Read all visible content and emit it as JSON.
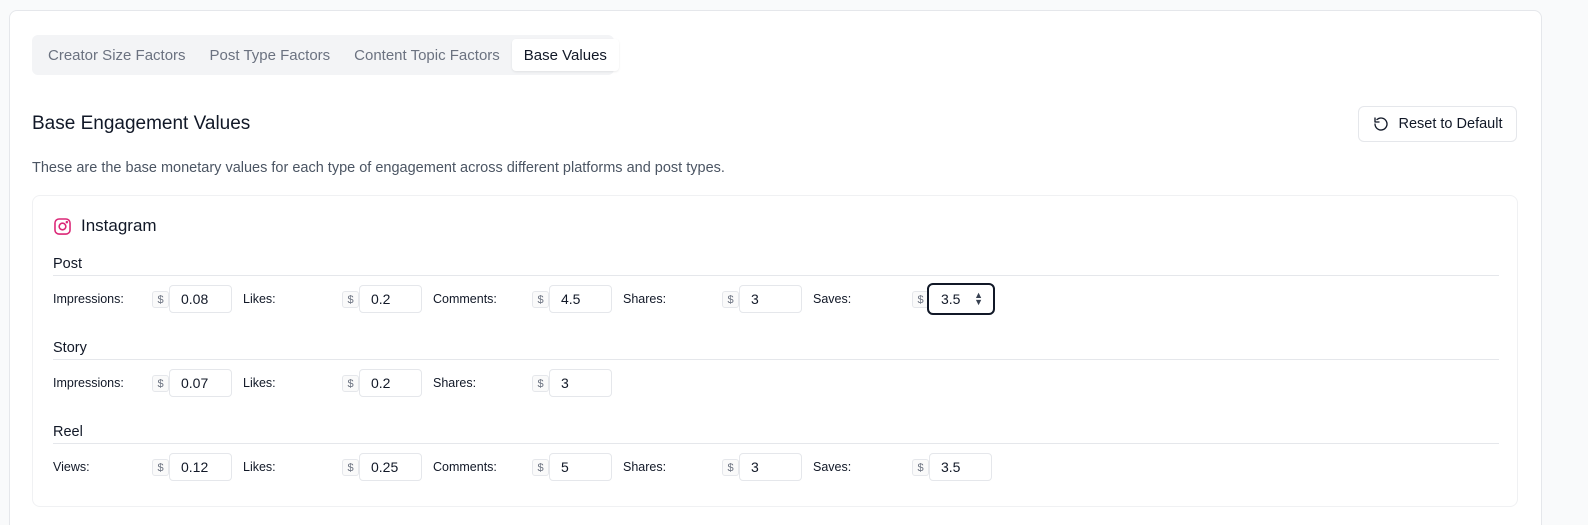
{
  "tabs": [
    {
      "label": "Creator Size Factors",
      "active": false
    },
    {
      "label": "Post Type Factors",
      "active": false
    },
    {
      "label": "Content Topic Factors",
      "active": false
    },
    {
      "label": "Base Values",
      "active": true
    }
  ],
  "section": {
    "title": "Base Engagement Values",
    "description": "These are the base monetary values for each type of engagement across different platforms and post types.",
    "reset_label": "Reset to Default"
  },
  "platform": {
    "name": "Instagram",
    "icon": "instagram-icon",
    "accent": "#db2777"
  },
  "currency_symbol": "$",
  "groups": {
    "post": {
      "title": "Post",
      "fields": [
        {
          "label": "Impressions:",
          "value": "0.08"
        },
        {
          "label": "Likes:",
          "value": "0.2"
        },
        {
          "label": "Comments:",
          "value": "4.5"
        },
        {
          "label": "Shares:",
          "value": "3"
        },
        {
          "label": "Saves:",
          "value": "3.5"
        }
      ]
    },
    "story": {
      "title": "Story",
      "fields": [
        {
          "label": "Impressions:",
          "value": "0.07"
        },
        {
          "label": "Likes:",
          "value": "0.2"
        },
        {
          "label": "Shares:",
          "value": "3"
        }
      ]
    },
    "reel": {
      "title": "Reel",
      "fields": [
        {
          "label": "Views:",
          "value": "0.12"
        },
        {
          "label": "Likes:",
          "value": "0.25"
        },
        {
          "label": "Comments:",
          "value": "5"
        },
        {
          "label": "Shares:",
          "value": "3"
        },
        {
          "label": "Saves:",
          "value": "3.5"
        }
      ]
    }
  }
}
